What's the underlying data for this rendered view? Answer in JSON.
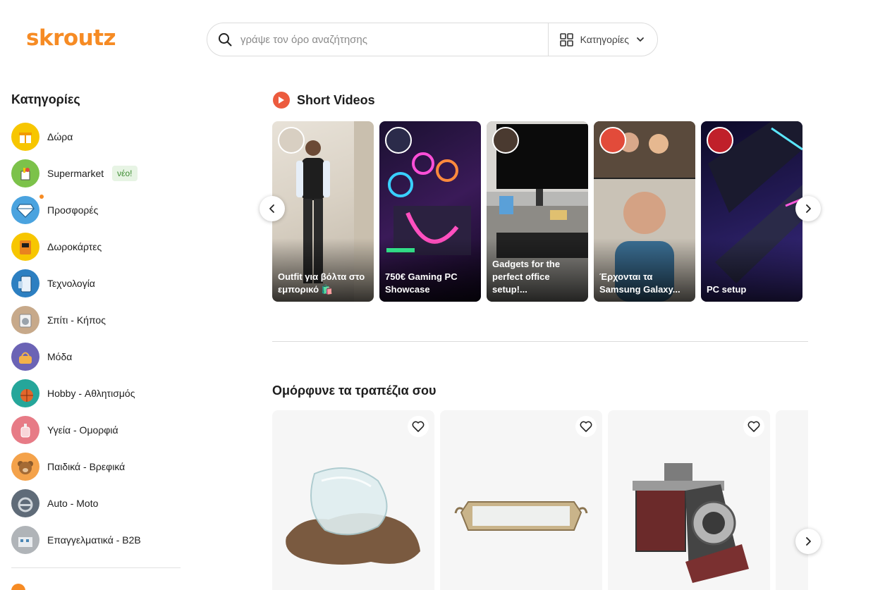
{
  "header": {
    "logo_text": "skroutz",
    "search_placeholder": "γράψε τον όρο αναζήτησης",
    "categories_label": "Κατηγορίες"
  },
  "sidebar": {
    "title": "Κατηγορίες",
    "items": [
      {
        "label": "Δώρα",
        "icon": "gift-icon",
        "color": "#f7c600"
      },
      {
        "label": "Supermarket",
        "icon": "shopping-bag-icon",
        "color": "#7cc24a",
        "badge": "νέο!"
      },
      {
        "label": "Προσφορές",
        "icon": "diamond-icon",
        "color": "#4aa3df"
      },
      {
        "label": "Δωροκάρτες",
        "icon": "gift-card-icon",
        "color": "#f7c600"
      },
      {
        "label": "Τεχνολογία",
        "icon": "smartphone-icon",
        "color": "#2c7fc1"
      },
      {
        "label": "Σπίτι - Κήπος",
        "icon": "washing-machine-icon",
        "color": "#c7a98a"
      },
      {
        "label": "Μόδα",
        "icon": "handbag-icon",
        "color": "#6b63b5"
      },
      {
        "label": "Hobby - Αθλητισμός",
        "icon": "basketball-icon",
        "color": "#25a69a"
      },
      {
        "label": "Υγεία - Ομορφιά",
        "icon": "perfume-icon",
        "color": "#e77b86"
      },
      {
        "label": "Παιδικά - Βρεφικά",
        "icon": "teddy-bear-icon",
        "color": "#f4a24a"
      },
      {
        "label": "Auto - Moto",
        "icon": "steering-wheel-icon",
        "color": "#5f6b78"
      },
      {
        "label": "Επαγγελματικά - B2B",
        "icon": "building-icon",
        "color": "#b0b4b8"
      }
    ]
  },
  "short_videos": {
    "title": "Short Videos",
    "videos": [
      {
        "title": "Outfit για βόλτα στο εμπορικό 🛍️"
      },
      {
        "title": "750€ Gaming PC Showcase"
      },
      {
        "title": "Gadgets for the perfect office setup!..."
      },
      {
        "title": "Έρχονται τα Samsung Galaxy..."
      },
      {
        "title": "PC setup"
      }
    ]
  },
  "products": {
    "title": "Ομόρφυνε τα τραπέζια σου",
    "items": [
      {
        "name": "glass-vase-on-driftwood"
      },
      {
        "name": "mirrored-tray"
      },
      {
        "name": "vintage-camera-decor"
      }
    ]
  }
}
